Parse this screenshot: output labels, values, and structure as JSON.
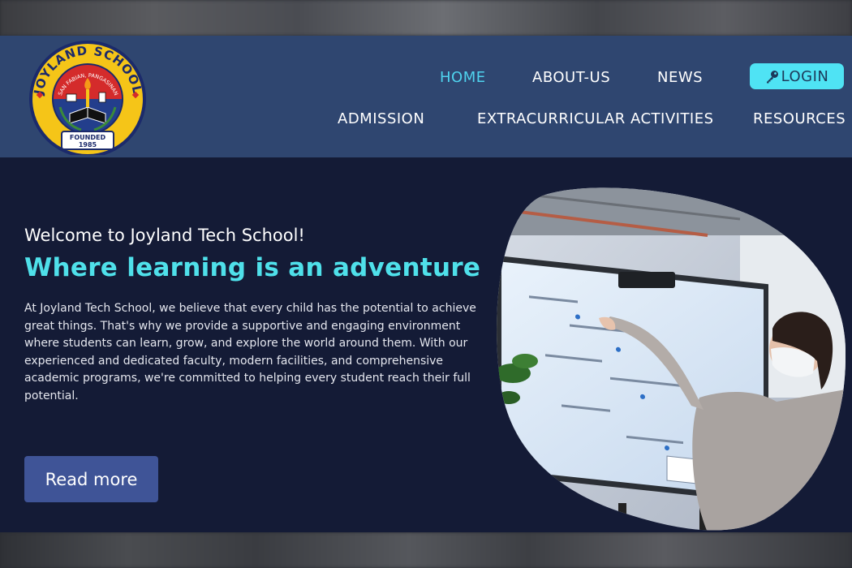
{
  "logo": {
    "name": "JOYLAND SCHOOL",
    "location": "SAN FABIAN, PANGASINAN",
    "founded_label": "FOUNDED",
    "founded_year": "1985",
    "colors": {
      "ring": "#f5c518",
      "ring_border": "#1b2a6b",
      "inner_top": "#d42b2b",
      "inner_bottom": "#233e8c"
    }
  },
  "nav": {
    "items": [
      {
        "label": "HOME",
        "active": true
      },
      {
        "label": "ABOUT-US",
        "active": false
      },
      {
        "label": "NEWS",
        "active": false
      },
      {
        "label": "ADMISSION",
        "active": false
      },
      {
        "label": "EXTRACURRICULAR ACTIVITIES",
        "active": false
      },
      {
        "label": "RESOURCES",
        "active": false
      }
    ],
    "login_label": "LOGIN",
    "login_icon": "key-icon"
  },
  "hero": {
    "welcome": "Welcome to Joyland Tech School!",
    "title": "Where learning is an adventure",
    "body": "At Joyland Tech School, we believe that every child has the potential to achieve great things. That's why we provide a supportive and engaging environment where students can learn, grow, and explore the world around them. With our experienced and dedicated faculty, modern facilities, and comprehensive academic programs, we're committed to helping every student reach their full potential.",
    "button_label": "Read more",
    "image_alt": "teacher-presenting-at-digital-screen"
  },
  "colors": {
    "header_bg": "#2f4670",
    "page_bg": "#141b36",
    "accent": "#4fe0ea",
    "login_bg": "#4fe3f4",
    "button_bg": "#3f5497"
  }
}
